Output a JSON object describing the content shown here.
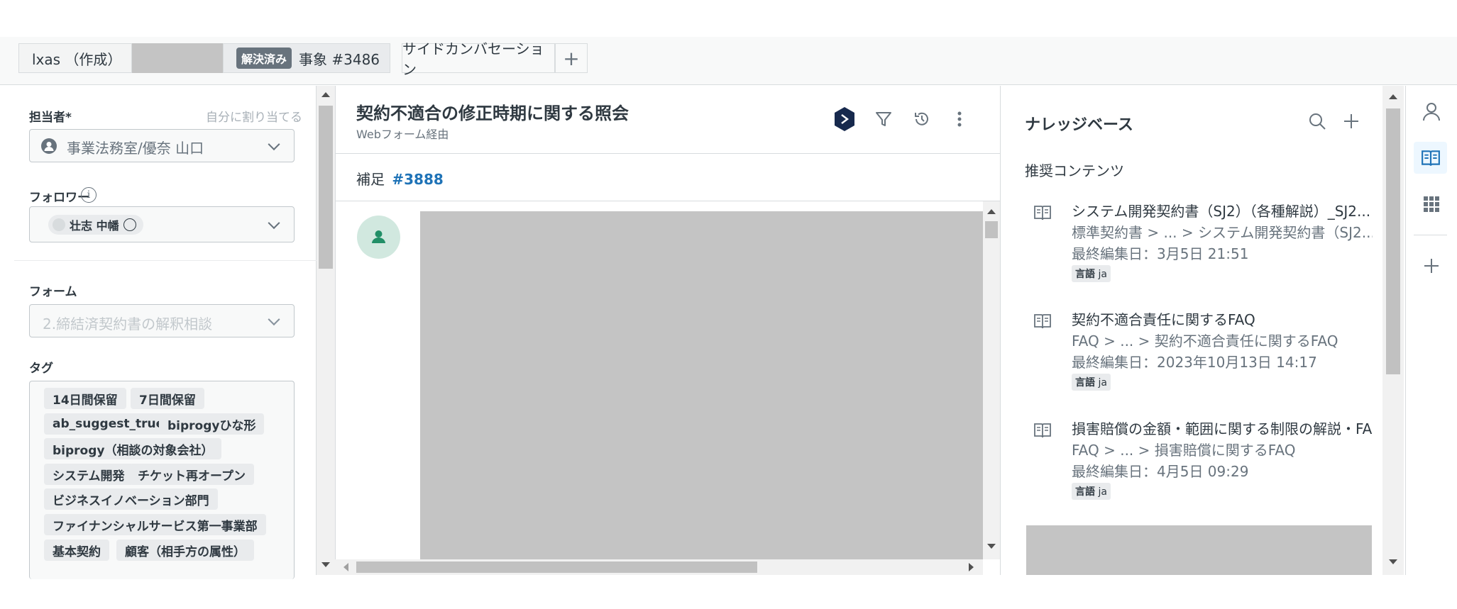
{
  "tabs": {
    "tab1_label": "lxas （作成）",
    "tab2_badge": "解決済み",
    "tab2_label": "事象 #3486",
    "tab3_label": "サイドカンバセーション",
    "plus": "+"
  },
  "left": {
    "assignee_label": "担当者*",
    "assign_self": "自分に割り当てる",
    "assignee_value": "事業法務室/優奈 山口",
    "followers_label": "フォロワー",
    "follower_name": "壮志 中幡",
    "form_label": "フォーム",
    "form_value": "2.締結済契約書の解釈相談",
    "tags_label": "タグ",
    "tags": [
      "14日間保留",
      "7日間保留",
      "ab_suggest_true",
      "biprogyひな形",
      "biprogy（相談の対象会社）",
      "システム開発",
      "チケット再オープン",
      "ビジネスイノベーション部門",
      "ファイナンシャルサービス第一事業部",
      "基本契約",
      "顧客（相手方の属性）"
    ]
  },
  "center": {
    "title": "契約不適合の修正時期に関する照会",
    "subtitle": "Webフォーム経由",
    "supplement_label": "補足",
    "supplement_link": "#3888"
  },
  "knowledge": {
    "title": "ナレッジベース",
    "recommended": "推奨コンテンツ",
    "lang_label": "言語",
    "lang_value": "ja",
    "items": [
      {
        "title": "システム開発契約書（SJ2）（各種解説）_SJ2...",
        "path": "標準契約書 > ... > システム開発契約書（SJ2...",
        "date": "最終編集日：3月5日 21:51"
      },
      {
        "title": "契約不適合責任に関するFAQ",
        "path": "FAQ > ... > 契約不適合責任に関するFAQ",
        "date": "最終編集日：2023年10月13日 14:17"
      },
      {
        "title": "損害賠償の金額・範囲に関する制限の解説・FAQ",
        "path": "FAQ > ... > 損害賠償に関するFAQ",
        "date": "最終編集日：4月5日 09:29"
      }
    ]
  },
  "colors": {
    "accent": "#1f73b7",
    "badge": "#68737d",
    "avatar_bg": "#d1e8df",
    "avatar_fg": "#228f67",
    "placeholder_gray": "#c4c4c4"
  }
}
